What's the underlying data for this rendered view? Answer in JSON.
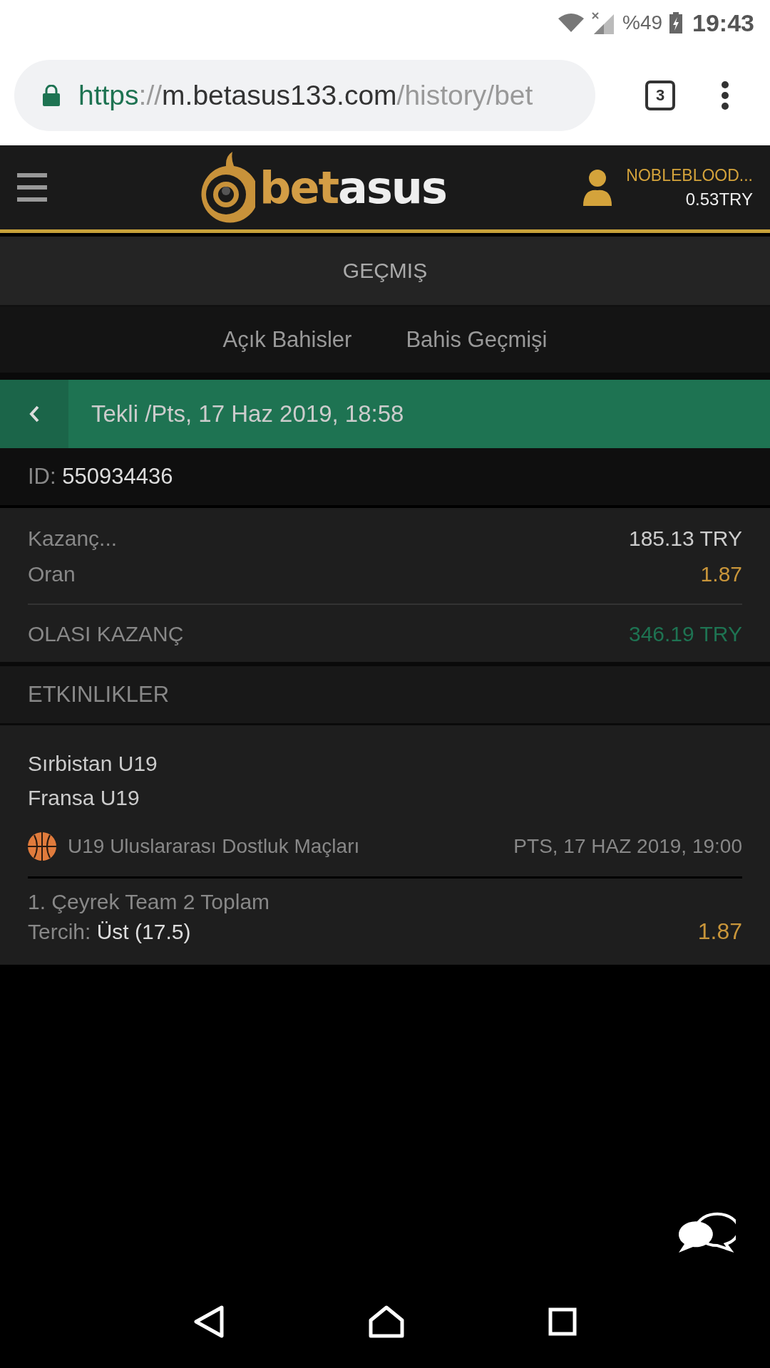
{
  "status_bar": {
    "battery": "%49",
    "time": "19:43"
  },
  "browser": {
    "url_scheme": "https",
    "url_sep": "://",
    "url_host": "m.betasus133.com",
    "url_path": "/history/bet",
    "tab_count": "3"
  },
  "header": {
    "logo_part_1": "bet",
    "logo_part_2": "asus",
    "username": "NOBLEBLOOD...",
    "balance": "0.53TRY"
  },
  "page_title": "GEÇMIŞ",
  "tabs": [
    {
      "label": "Açık Bahisler"
    },
    {
      "label": "Bahis Geçmişi"
    }
  ],
  "bet_header": "Tekli /Pts, 17 Haz 2019, 18:58",
  "bet_id": {
    "label": "ID:",
    "value": "550934436"
  },
  "summary": [
    {
      "label": "Kazanç...",
      "value": "185.13 TRY",
      "kind": "plain"
    },
    {
      "label": "Oran",
      "value": "1.87",
      "kind": "odds"
    },
    {
      "label": "OLASI KAZANÇ",
      "value": "346.19 TRY",
      "kind": "total"
    }
  ],
  "events_title": "ETKINLIKLER",
  "events": [
    {
      "teams": [
        "Sırbistan U19",
        "Fransa U19"
      ],
      "league": "U19 Uluslararası Dostluk Maçları",
      "start": "PTS, 17 HAZ 2019, 19:00",
      "market": "1. Çeyrek Team 2 Toplam",
      "choice_label": "Tercih:",
      "choice": "Üst (17.5)",
      "odds": "1.87"
    }
  ]
}
